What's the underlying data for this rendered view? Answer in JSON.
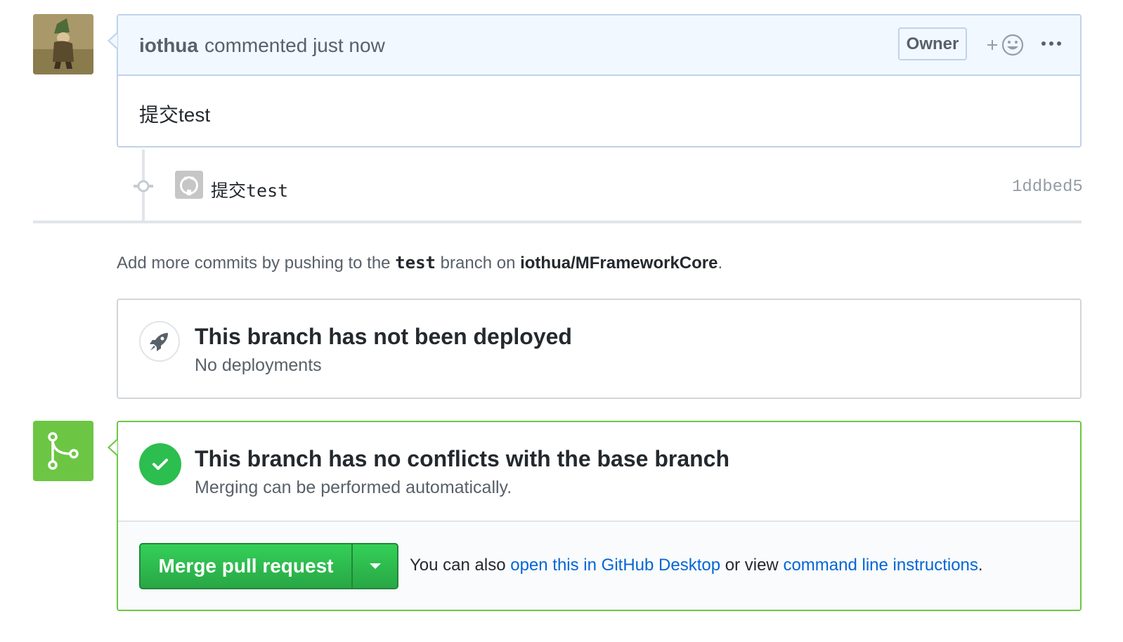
{
  "comment": {
    "author": "iothua",
    "action": "commented just now",
    "badge": "Owner",
    "body": "提交test"
  },
  "commit": {
    "message": "提交test",
    "sha": "1ddbed5"
  },
  "hint": {
    "prefix": "Add more commits by pushing to the",
    "branch": "test",
    "middle": "branch on",
    "repo": "iothua/MFrameworkCore",
    "suffix": "."
  },
  "deploy": {
    "title": "This branch has not been deployed",
    "subtitle": "No deployments"
  },
  "merge": {
    "title": "This branch has no conflicts with the base branch",
    "subtitle": "Merging can be performed automatically.",
    "button_label": "Merge pull request",
    "also_prefix": "You can also",
    "desktop_link": "open this in GitHub Desktop",
    "also_middle": "or view",
    "cli_link": "command line instructions",
    "also_suffix": "."
  },
  "icons": {
    "avatar": "user-avatar",
    "reaction": "add-reaction-icon",
    "more": "kebab-menu-icon",
    "commit": "git-commit-icon",
    "commit_avatar": "github-octocat-icon",
    "deploy": "rocket-icon",
    "merge": "git-merge-icon",
    "check": "check-icon",
    "dropdown": "triangle-down-icon"
  },
  "colors": {
    "accent_blue": "#0366d6",
    "success_green": "#2cbe4e",
    "merge_green": "#6cc644",
    "header_bg": "#f1f8ff"
  }
}
